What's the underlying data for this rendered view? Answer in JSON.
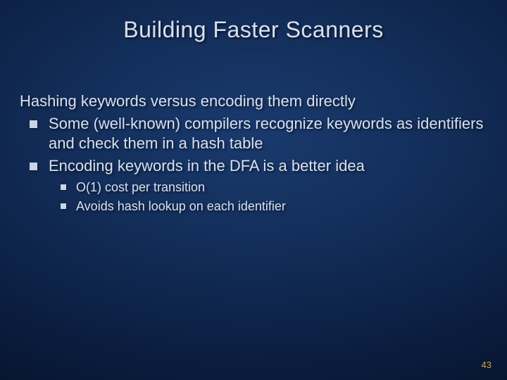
{
  "title": "Building Faster Scanners",
  "lead": "Hashing keywords versus encoding them directly",
  "bullets": [
    "Some (well-known) compilers recognize keywords as identifiers and check them in a hash table",
    "Encoding keywords in the DFA is a better idea"
  ],
  "subbullets": [
    "O(1) cost per transition",
    "Avoids hash lookup on each identifier"
  ],
  "page_number": "43"
}
